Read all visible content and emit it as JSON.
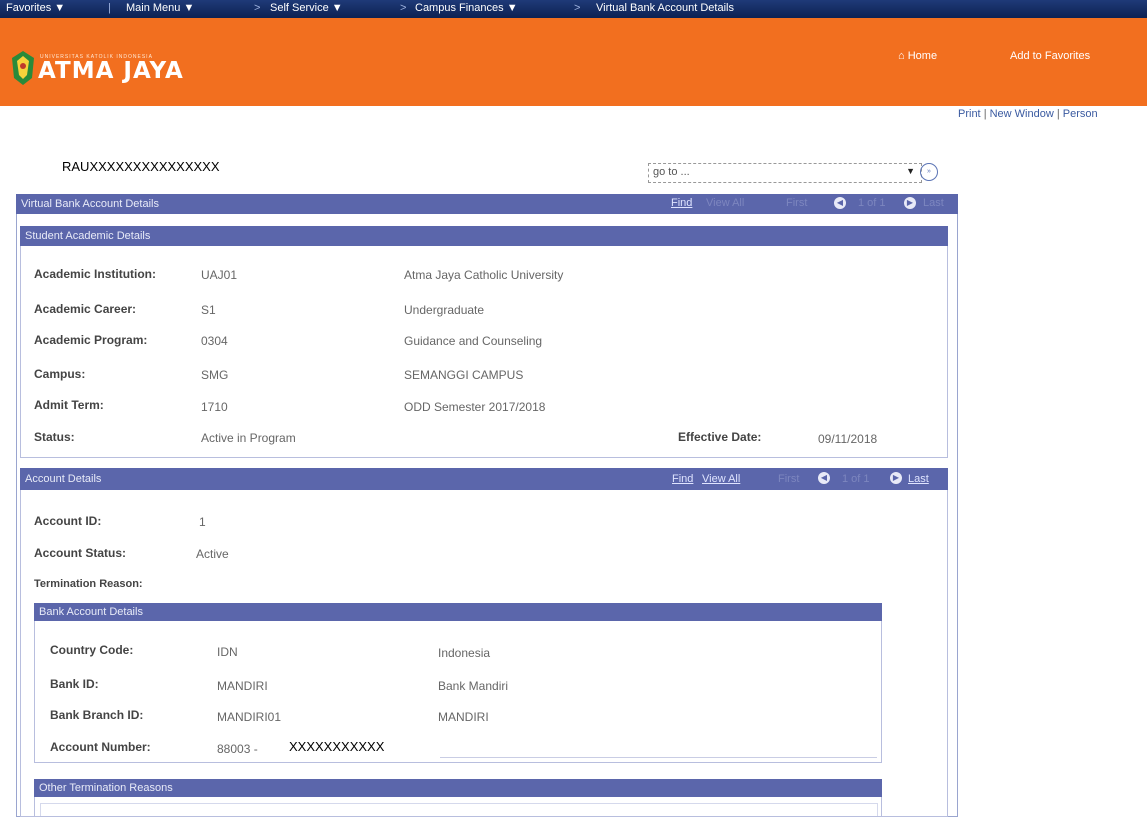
{
  "topnav": {
    "favorites": "Favorites ▼",
    "main_menu": "Main Menu ▼",
    "sep1": ">",
    "self_service": "Self Service ▼",
    "sep2": ">",
    "campus_finances": "Campus Finances ▼",
    "sep3": ">",
    "current": "Virtual Bank Account Details"
  },
  "brand": {
    "logo_text": "ATMA JAYA",
    "tagline": "UNIVERSITAS KATOLIK INDONESIA",
    "home": "Home",
    "add_fav": "Add to Favorites",
    "color": "#f26f1f"
  },
  "toolbar": {
    "print": "Print",
    "sep": "|",
    "new_window": "New Window",
    "sep2": "|",
    "personalize": "Person"
  },
  "user": {
    "id": "RAUXXXXXXXXXXXXXXX"
  },
  "goto": {
    "value": "go to ...",
    "arrow": "▼",
    "btn": "»"
  },
  "main_header": {
    "title": "Virtual Bank Account Details",
    "find": "Find",
    "view_all": "View All",
    "first": "First",
    "prev_icon": "◀",
    "range": "1 of 1",
    "next_icon": "▶",
    "last": "Last"
  },
  "academic": {
    "title": "Student Academic Details",
    "rows": [
      {
        "label": "Academic Institution:",
        "code": "UAJ01",
        "desc": "Atma Jaya Catholic University"
      },
      {
        "label": "Academic Career:",
        "code": "S1",
        "desc": "Undergraduate"
      },
      {
        "label": "Academic Program:",
        "code": "0304",
        "desc": "Guidance and Counseling"
      },
      {
        "label": "Campus:",
        "code": "SMG",
        "desc": "SEMANGGI CAMPUS"
      },
      {
        "label": "Admit Term:",
        "code": "1710",
        "desc": "ODD Semester 2017/2018"
      }
    ],
    "status_label": "Status:",
    "status_value": "Active in Program",
    "eff_label": "Effective Date:",
    "eff_value": "09/11/2018"
  },
  "account": {
    "title": "Account Details",
    "find": "Find",
    "view_all": "View All",
    "first": "First",
    "prev_icon": "◀",
    "range": "1 of 1",
    "next_icon": "▶",
    "last": "Last",
    "id_label": "Account ID:",
    "id_value": "1",
    "status_label": "Account Status:",
    "status_value": "Active",
    "term_label": "Termination Reason:"
  },
  "bank": {
    "title": "Bank Account Details",
    "rows": [
      {
        "label": "Country Code:",
        "code": "IDN",
        "desc": "Indonesia"
      },
      {
        "label": "Bank ID:",
        "code": "MANDIRI",
        "desc": "Bank Mandiri"
      },
      {
        "label": "Bank Branch ID:",
        "code": "MANDIRI01",
        "desc": "MANDIRI"
      }
    ],
    "acct_label": "Account Number:",
    "acct_prefix": "88003 -",
    "acct_masked": "XXXXXXXXXXX"
  },
  "other": {
    "title": "Other Termination Reasons"
  }
}
